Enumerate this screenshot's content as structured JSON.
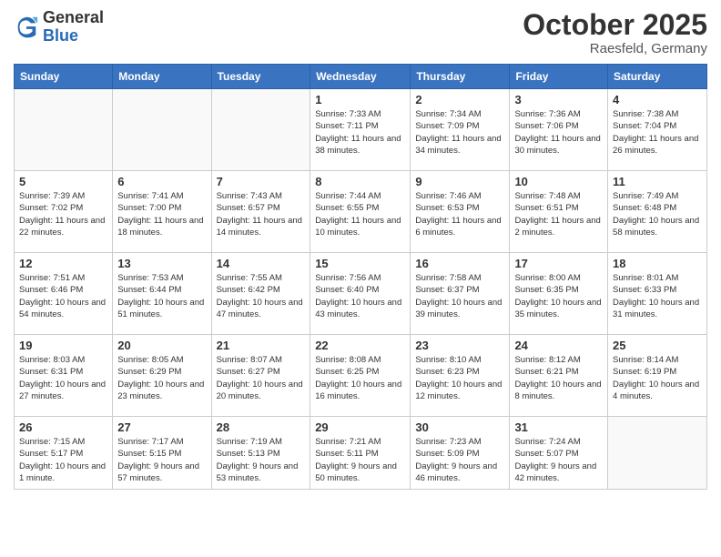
{
  "header": {
    "logo_general": "General",
    "logo_blue": "Blue",
    "month_title": "October 2025",
    "location": "Raesfeld, Germany"
  },
  "weekdays": [
    "Sunday",
    "Monday",
    "Tuesday",
    "Wednesday",
    "Thursday",
    "Friday",
    "Saturday"
  ],
  "weeks": [
    [
      {
        "day": "",
        "info": ""
      },
      {
        "day": "",
        "info": ""
      },
      {
        "day": "",
        "info": ""
      },
      {
        "day": "1",
        "info": "Sunrise: 7:33 AM\nSunset: 7:11 PM\nDaylight: 11 hours\nand 38 minutes."
      },
      {
        "day": "2",
        "info": "Sunrise: 7:34 AM\nSunset: 7:09 PM\nDaylight: 11 hours\nand 34 minutes."
      },
      {
        "day": "3",
        "info": "Sunrise: 7:36 AM\nSunset: 7:06 PM\nDaylight: 11 hours\nand 30 minutes."
      },
      {
        "day": "4",
        "info": "Sunrise: 7:38 AM\nSunset: 7:04 PM\nDaylight: 11 hours\nand 26 minutes."
      }
    ],
    [
      {
        "day": "5",
        "info": "Sunrise: 7:39 AM\nSunset: 7:02 PM\nDaylight: 11 hours\nand 22 minutes."
      },
      {
        "day": "6",
        "info": "Sunrise: 7:41 AM\nSunset: 7:00 PM\nDaylight: 11 hours\nand 18 minutes."
      },
      {
        "day": "7",
        "info": "Sunrise: 7:43 AM\nSunset: 6:57 PM\nDaylight: 11 hours\nand 14 minutes."
      },
      {
        "day": "8",
        "info": "Sunrise: 7:44 AM\nSunset: 6:55 PM\nDaylight: 11 hours\nand 10 minutes."
      },
      {
        "day": "9",
        "info": "Sunrise: 7:46 AM\nSunset: 6:53 PM\nDaylight: 11 hours\nand 6 minutes."
      },
      {
        "day": "10",
        "info": "Sunrise: 7:48 AM\nSunset: 6:51 PM\nDaylight: 11 hours\nand 2 minutes."
      },
      {
        "day": "11",
        "info": "Sunrise: 7:49 AM\nSunset: 6:48 PM\nDaylight: 10 hours\nand 58 minutes."
      }
    ],
    [
      {
        "day": "12",
        "info": "Sunrise: 7:51 AM\nSunset: 6:46 PM\nDaylight: 10 hours\nand 54 minutes."
      },
      {
        "day": "13",
        "info": "Sunrise: 7:53 AM\nSunset: 6:44 PM\nDaylight: 10 hours\nand 51 minutes."
      },
      {
        "day": "14",
        "info": "Sunrise: 7:55 AM\nSunset: 6:42 PM\nDaylight: 10 hours\nand 47 minutes."
      },
      {
        "day": "15",
        "info": "Sunrise: 7:56 AM\nSunset: 6:40 PM\nDaylight: 10 hours\nand 43 minutes."
      },
      {
        "day": "16",
        "info": "Sunrise: 7:58 AM\nSunset: 6:37 PM\nDaylight: 10 hours\nand 39 minutes."
      },
      {
        "day": "17",
        "info": "Sunrise: 8:00 AM\nSunset: 6:35 PM\nDaylight: 10 hours\nand 35 minutes."
      },
      {
        "day": "18",
        "info": "Sunrise: 8:01 AM\nSunset: 6:33 PM\nDaylight: 10 hours\nand 31 minutes."
      }
    ],
    [
      {
        "day": "19",
        "info": "Sunrise: 8:03 AM\nSunset: 6:31 PM\nDaylight: 10 hours\nand 27 minutes."
      },
      {
        "day": "20",
        "info": "Sunrise: 8:05 AM\nSunset: 6:29 PM\nDaylight: 10 hours\nand 23 minutes."
      },
      {
        "day": "21",
        "info": "Sunrise: 8:07 AM\nSunset: 6:27 PM\nDaylight: 10 hours\nand 20 minutes."
      },
      {
        "day": "22",
        "info": "Sunrise: 8:08 AM\nSunset: 6:25 PM\nDaylight: 10 hours\nand 16 minutes."
      },
      {
        "day": "23",
        "info": "Sunrise: 8:10 AM\nSunset: 6:23 PM\nDaylight: 10 hours\nand 12 minutes."
      },
      {
        "day": "24",
        "info": "Sunrise: 8:12 AM\nSunset: 6:21 PM\nDaylight: 10 hours\nand 8 minutes."
      },
      {
        "day": "25",
        "info": "Sunrise: 8:14 AM\nSunset: 6:19 PM\nDaylight: 10 hours\nand 4 minutes."
      }
    ],
    [
      {
        "day": "26",
        "info": "Sunrise: 7:15 AM\nSunset: 5:17 PM\nDaylight: 10 hours\nand 1 minute."
      },
      {
        "day": "27",
        "info": "Sunrise: 7:17 AM\nSunset: 5:15 PM\nDaylight: 9 hours\nand 57 minutes."
      },
      {
        "day": "28",
        "info": "Sunrise: 7:19 AM\nSunset: 5:13 PM\nDaylight: 9 hours\nand 53 minutes."
      },
      {
        "day": "29",
        "info": "Sunrise: 7:21 AM\nSunset: 5:11 PM\nDaylight: 9 hours\nand 50 minutes."
      },
      {
        "day": "30",
        "info": "Sunrise: 7:23 AM\nSunset: 5:09 PM\nDaylight: 9 hours\nand 46 minutes."
      },
      {
        "day": "31",
        "info": "Sunrise: 7:24 AM\nSunset: 5:07 PM\nDaylight: 9 hours\nand 42 minutes."
      },
      {
        "day": "",
        "info": ""
      }
    ]
  ]
}
